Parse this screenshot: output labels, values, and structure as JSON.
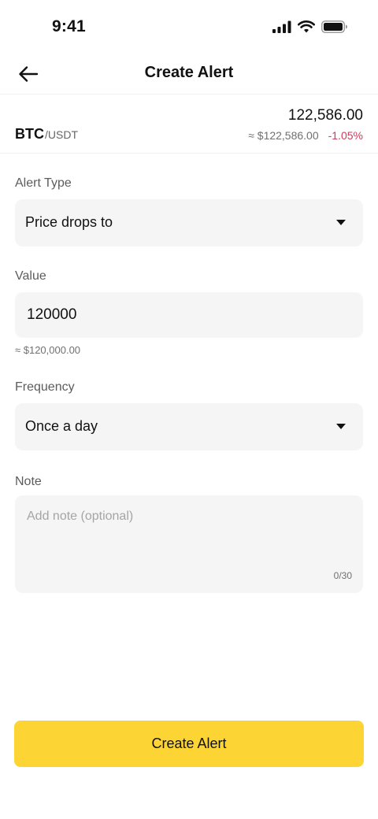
{
  "status_bar": {
    "time": "9:41",
    "icons": [
      "signal-icon",
      "wifi-icon",
      "battery-icon"
    ]
  },
  "nav": {
    "title": "Create Alert",
    "back_icon": "arrow-left-icon"
  },
  "pair": {
    "base": "BTC",
    "quote": "/USDT",
    "price": "122,586.00",
    "price_usd": "≈ $122,586.00",
    "change": "-1.05%",
    "change_color": "#cf3a5b"
  },
  "form": {
    "alert_type": {
      "label": "Alert Type",
      "selected": "Price drops to",
      "icon": "caret-down-icon"
    },
    "value": {
      "label": "Value",
      "value": "120000",
      "helper": "≈ $120,000.00"
    },
    "frequency": {
      "label": "Frequency",
      "selected": "Once a day",
      "icon": "caret-down-icon"
    },
    "note": {
      "label": "Note",
      "placeholder": "Add note (optional)",
      "counter": "0/30"
    }
  },
  "submit": {
    "label": "Create Alert",
    "color": "#fcd535"
  }
}
